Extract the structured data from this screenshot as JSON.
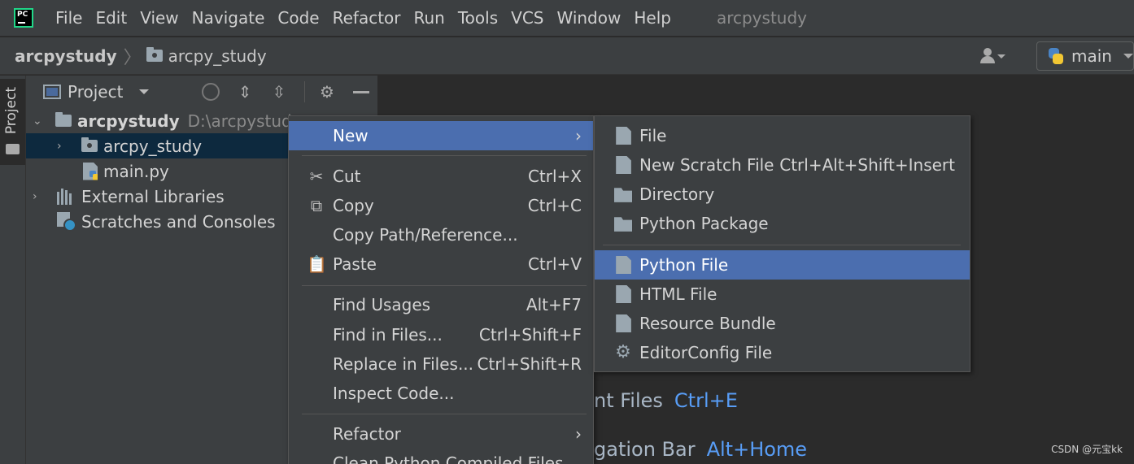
{
  "menubar": {
    "logo_text": "PC",
    "items": [
      "File",
      "Edit",
      "View",
      "Navigate",
      "Code",
      "Refactor",
      "Run",
      "Tools",
      "VCS",
      "Window",
      "Help"
    ],
    "project_name": "arcpystudy"
  },
  "navbar": {
    "root": "arcpystudy",
    "child": "arcpy_study",
    "run_config": "main"
  },
  "tool_strip": {
    "project_tab": "Project"
  },
  "project_panel": {
    "title": "Project",
    "tree": {
      "root_name": "arcpystudy",
      "root_path": "D:\\arcpystudy",
      "folder": "arcpy_study",
      "file": "main.py",
      "libraries": "External Libraries",
      "scratches": "Scratches and Consoles"
    }
  },
  "context_menu": {
    "new": "New",
    "cut": "Cut",
    "cut_key": "Ctrl+X",
    "copy": "Copy",
    "copy_key": "Ctrl+C",
    "copy_path": "Copy Path/Reference...",
    "paste": "Paste",
    "paste_key": "Ctrl+V",
    "find_usages": "Find Usages",
    "find_usages_key": "Alt+F7",
    "find_in_files": "Find in Files...",
    "find_in_files_key": "Ctrl+Shift+F",
    "replace_in_files": "Replace in Files...",
    "replace_in_files_key": "Ctrl+Shift+R",
    "inspect_code": "Inspect Code...",
    "refactor": "Refactor",
    "clean_python": "Clean Python Compiled Files"
  },
  "submenu": {
    "file": "File",
    "scratch": "New Scratch File",
    "scratch_key": "Ctrl+Alt+Shift+Insert",
    "directory": "Directory",
    "python_package": "Python Package",
    "python_file": "Python File",
    "html_file": "HTML File",
    "resource_bundle": "Resource Bundle",
    "editorconfig": "EditorConfig File"
  },
  "editor_hints": {
    "recent_files": "nt Files",
    "recent_files_key": "Ctrl+E",
    "nav_bar": "gation Bar",
    "nav_bar_key": "Alt+Home"
  },
  "watermark": "CSDN @元宝kk",
  "colors": {
    "selection": "#4b6eaf",
    "tree_selection": "#0d293e",
    "shortcut_link": "#589df6"
  }
}
